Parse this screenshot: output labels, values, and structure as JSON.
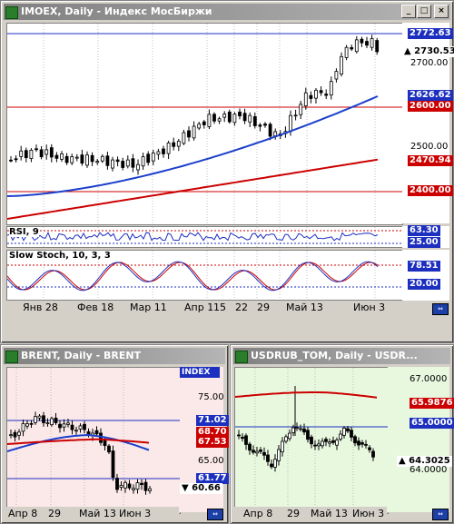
{
  "main": {
    "title": "IMOEX, Daily - Индекс МосБиржи",
    "price_labels": [
      "2700.00",
      "2500.00"
    ],
    "tags": [
      {
        "text": "2772.63",
        "color": "#1c2fbf"
      },
      {
        "text": "▲ 2730.53",
        "color": "#000000",
        "bg": "#ffffff"
      },
      {
        "text": "2626.62",
        "color": "#1c2fbf"
      },
      {
        "text": "2600.00",
        "color": "#cc0000"
      },
      {
        "text": "2470.94",
        "color": "#cc0000"
      },
      {
        "text": "2400.00",
        "color": "#cc0000"
      }
    ],
    "rsi": {
      "label": "RSI, 9",
      "tag1": "63.30",
      "tag2": "25.00"
    },
    "stoch": {
      "label": "Slow Stoch, 10, 3, 3",
      "tag1": "78.51",
      "tag2": "20.00"
    },
    "xlabels": [
      "Янв 28",
      "Фев 18",
      "Мар 11",
      "Апр 1",
      "15",
      "22",
      "29",
      "Май 13",
      "Июн 3"
    ]
  },
  "brent": {
    "title": "BRENT, Daily - BRENT",
    "badge": "INDEX",
    "price_labels": [
      "75.00",
      "65.00"
    ],
    "tags": [
      {
        "text": "71.02",
        "color": "#1c2fbf"
      },
      {
        "text": "68.70",
        "color": "#cc0000"
      },
      {
        "text": "67.53",
        "color": "#cc0000"
      },
      {
        "text": "61.77",
        "color": "#1c2fbf"
      },
      {
        "text": "▼ 60.66",
        "color": "#000000"
      }
    ],
    "xlabels": [
      "Апр 8",
      "29",
      "Май 13",
      "Июн 3"
    ]
  },
  "usd": {
    "title": "USDRUB_TOM, Daily - USDR...",
    "price_labels": [
      "67.0000",
      "64.0000"
    ],
    "tags": [
      {
        "text": "65.9876",
        "color": "#cc0000"
      },
      {
        "text": "65.0000",
        "color": "#1c2fbf"
      },
      {
        "text": "▲ 64.3025",
        "color": "#000000"
      }
    ],
    "xlabels": [
      "Апр 8",
      "29",
      "Май 13",
      "Июн 3"
    ]
  },
  "buttons": {
    "min": "_",
    "max": "□",
    "close": "×"
  },
  "sync_icon": "sync-icon"
}
